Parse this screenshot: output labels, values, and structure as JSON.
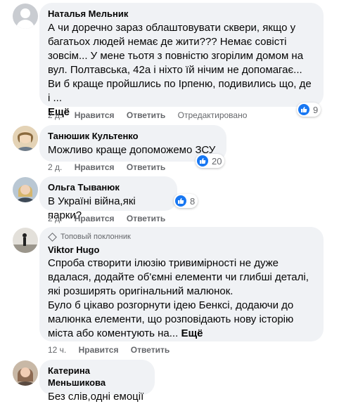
{
  "colors": {
    "bubble": "#f0f2f5",
    "meta": "#65676b",
    "like": "#1877f2"
  },
  "comments": [
    {
      "author": "Наталья Мельник",
      "text": "А чи доречно зараз облаштовувати сквери, якщо у багатьох людей немає де жити??? Немає совісті зовсім... У мене тьотя з повністю згорілим домом на вул. Полтавська, 42а і ніхто їй нічим не допомагає... Ви б краще пройшлись по Ірпеню, подивились що, де і ...",
      "more": "Ещё",
      "time": "2 д.",
      "like": "Нравится",
      "reply": "Ответить",
      "edited": "Отредактировано",
      "reactions": "9"
    },
    {
      "author": "Танюшик Культенко",
      "text": "Можливо краще допоможемо ЗСУ",
      "time": "2 д.",
      "like": "Нравится",
      "reply": "Ответить",
      "reactions": "20"
    },
    {
      "author": "Ольга Тыванюк",
      "text": "В Україні війна,які парки?",
      "time": "2 д.",
      "like": "Нравится",
      "reply": "Ответить",
      "reactions": "8"
    },
    {
      "badge": "Топовый поклонник",
      "author": "Viktor Hugo",
      "text": "Спроба створити ілюзію тривимірності не дуже вдалася, додайте об'ємні елементи чи глибші деталі, які розширять оригінальний малюнок.\nБуло б цікаво розгорнути ідею Бенксі, додаючи до малюнка елементи, що розповідають нову історію міста або коментують на...",
      "more": "Ещё",
      "time": "12 ч.",
      "like": "Нравится",
      "reply": "Ответить"
    },
    {
      "author": "Катерина Меньшикова",
      "text": "Без слів,одні емоції"
    }
  ]
}
